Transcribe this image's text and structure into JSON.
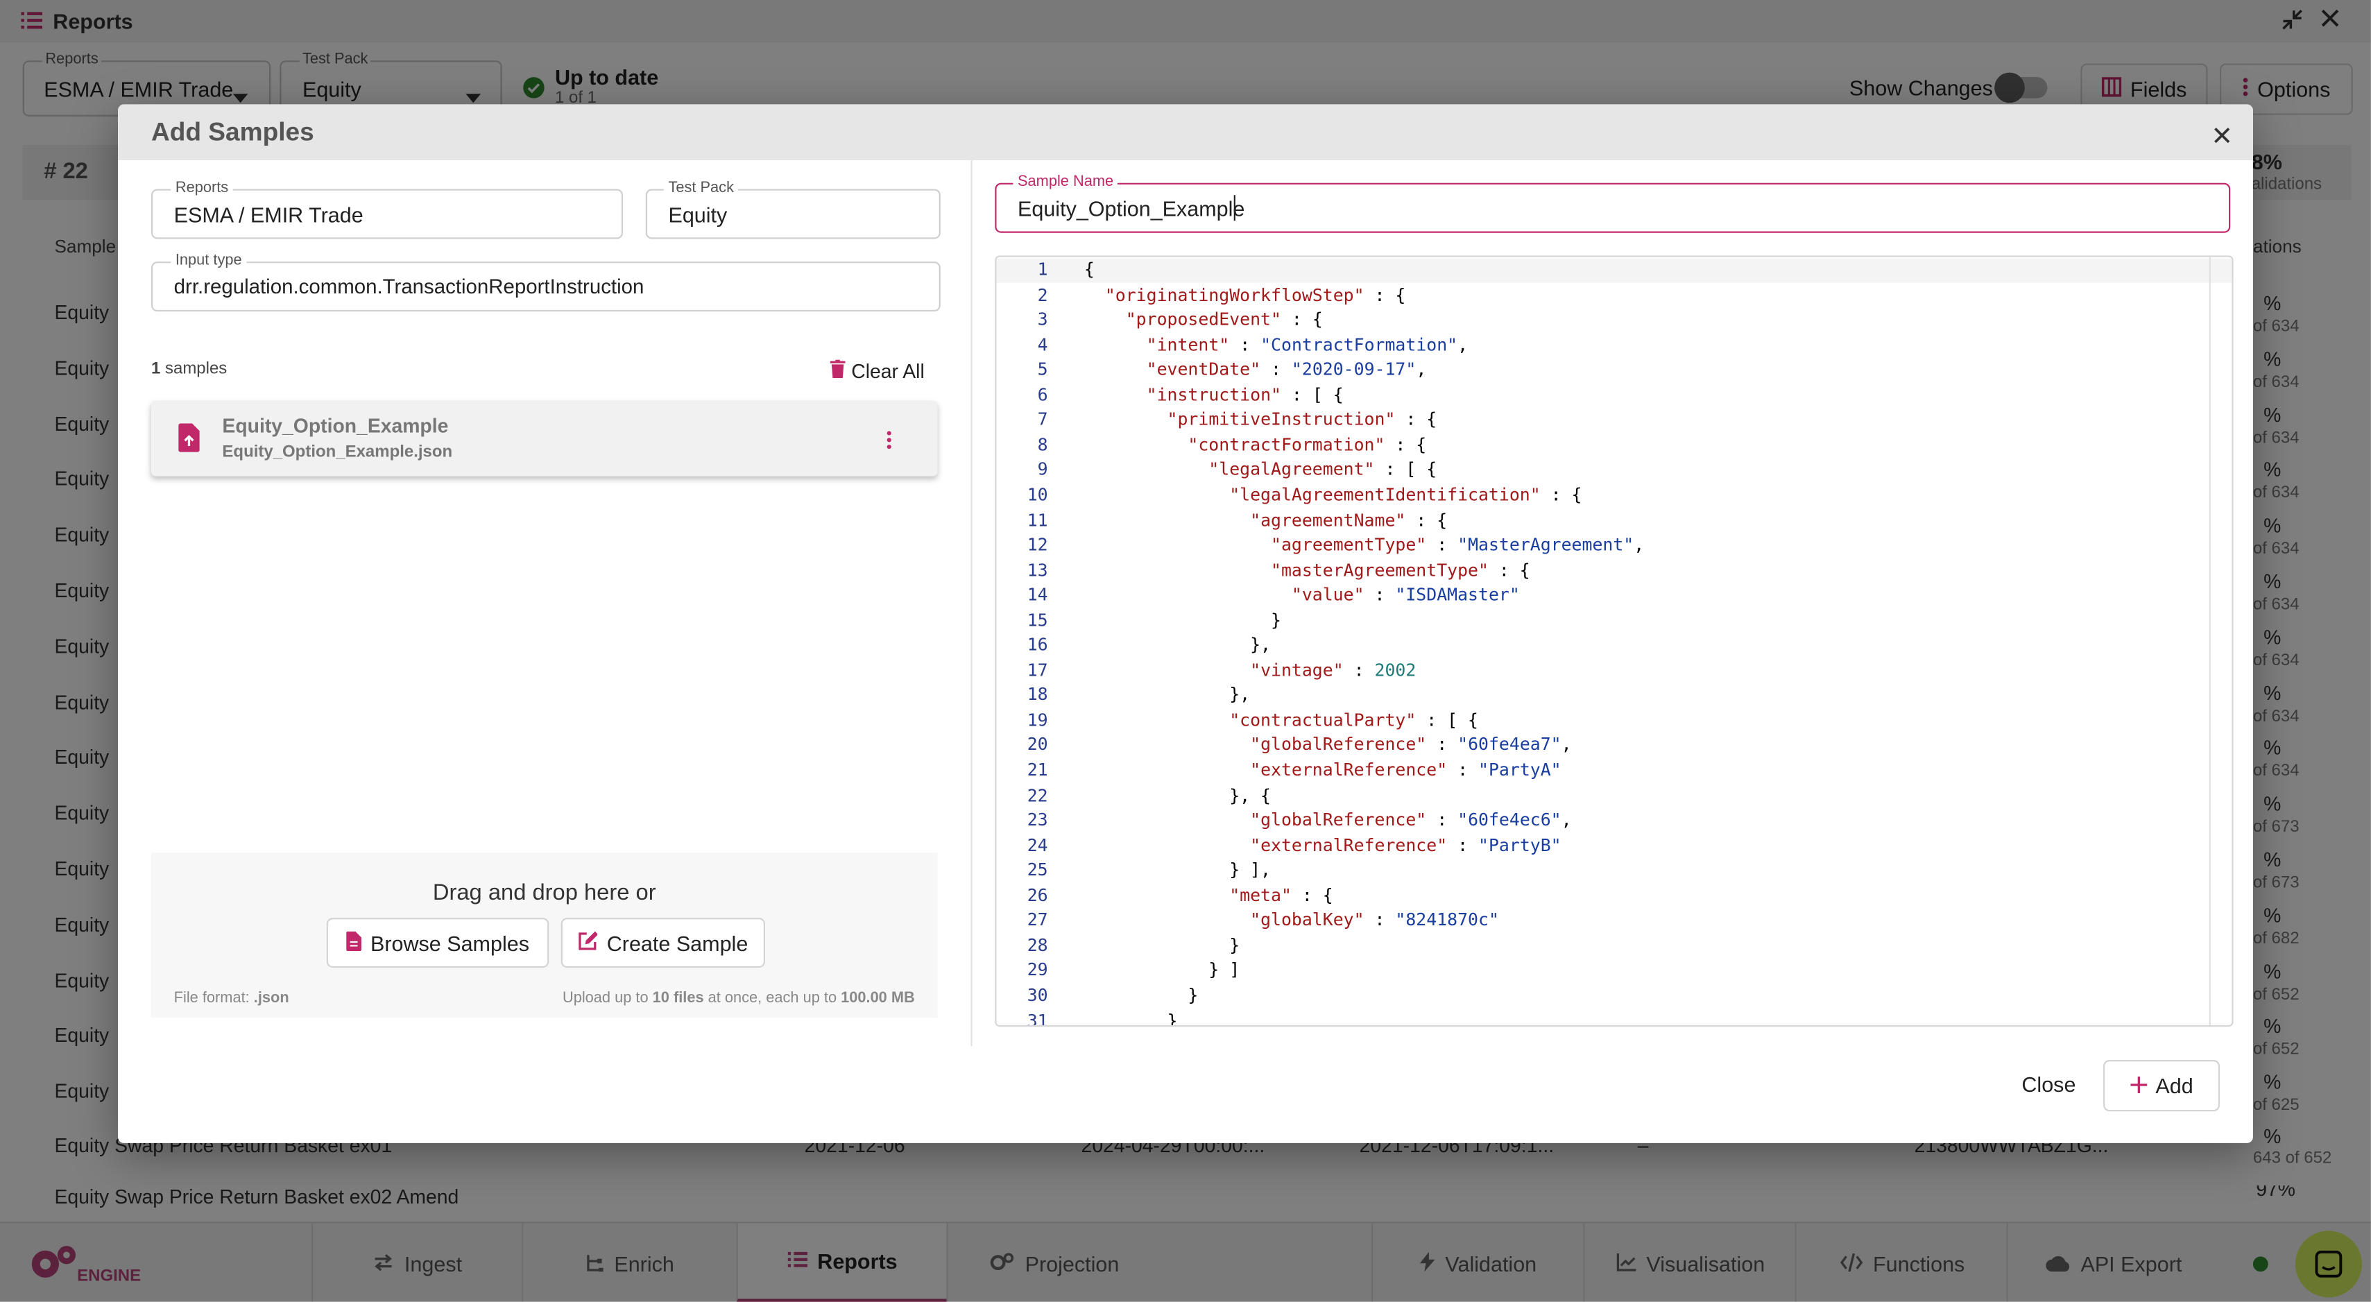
{
  "app": {
    "title": "Reports",
    "toolbar": {
      "reports_label": "Reports",
      "reports_value": "ESMA / EMIR Trade",
      "testpack_label": "Test Pack",
      "testpack_value": "Equity",
      "status_title": "Up to date",
      "status_sub": "1 of 1",
      "show_changes_label": "Show Changes",
      "fields_label": "Fields",
      "options_label": "Options"
    },
    "count_label": "# 22",
    "stat_pct": "8%",
    "stat_label": "alidations",
    "col_sample": "Sample",
    "col_validations": "ations",
    "rows": [
      {
        "name": "Equity",
        "pct": "%",
        "sub": "of 634"
      },
      {
        "name": "Equity",
        "pct": "%",
        "sub": "of 634"
      },
      {
        "name": "Equity",
        "pct": "%",
        "sub": "of 634"
      },
      {
        "name": "Equity",
        "pct": "%",
        "sub": "of 634"
      },
      {
        "name": "Equity",
        "pct": "%",
        "sub": "of 634"
      },
      {
        "name": "Equity",
        "pct": "%",
        "sub": "of 634"
      },
      {
        "name": "Equity",
        "pct": "%",
        "sub": "of 634"
      },
      {
        "name": "Equity",
        "pct": "%",
        "sub": "of 634"
      },
      {
        "name": "Equity",
        "pct": "%",
        "sub": "of 634"
      },
      {
        "name": "Equity",
        "pct": "%",
        "sub": "of 673"
      },
      {
        "name": "Equity",
        "pct": "%",
        "sub": "of 673"
      },
      {
        "name": "Equity",
        "pct": "%",
        "sub": "of 682"
      },
      {
        "name": "Equity",
        "pct": "%",
        "sub": "of 652"
      },
      {
        "name": "Equity",
        "pct": "%",
        "sub": "of 652"
      },
      {
        "name": "Equity",
        "pct": "%",
        "sub": "of 625"
      }
    ],
    "bottom_row": {
      "name": "Equity Swap Price Return Basket ex01",
      "c1": "2021-12-06",
      "c2": "2024-04-29T00:00:...",
      "c3": "2021-12-06T17:09:1...",
      "c4": "–",
      "c5": "213800WWTABZ1G...",
      "pct": "%",
      "sub": "643 of 652"
    },
    "cut_row": {
      "name": "Equity Swap Price Return Basket ex02 Amend",
      "pct": "97%"
    },
    "nav": {
      "logo_text": "ENGINE",
      "tabs": [
        "Ingest",
        "Enrich",
        "Reports",
        "Projection",
        "Validation",
        "Visualisation",
        "Functions",
        "API Export"
      ]
    },
    "colors": {
      "accent": "#c0286a",
      "nav_active": "#b8457b",
      "status_green": "#2e8b2e",
      "chat": "#d4ef5c"
    }
  },
  "modal": {
    "title": "Add Samples",
    "reports_label": "Reports",
    "reports_value": "ESMA / EMIR Trade",
    "testpack_label": "Test Pack",
    "testpack_value": "Equity",
    "input_type_label": "Input type",
    "input_type_value": "drr.regulation.common.TransactionReportInstruction",
    "samples_count": "1",
    "samples_label": " samples",
    "clear_all": "Clear All",
    "sample": {
      "name": "Equity_Option_Example",
      "file": "Equity_Option_Example.json"
    },
    "dropzone": {
      "text": "Drag and drop here or",
      "browse": "Browse Samples",
      "create": "Create Sample",
      "format_prefix": "File format: ",
      "format_value": ".json",
      "upload_1": "Upload up to ",
      "upload_2": "10 files",
      "upload_3": " at once, each up to ",
      "upload_4": "100.00 MB"
    },
    "sample_name_label": "Sample Name",
    "sample_name_value": "Equity_Option_Example",
    "code_lines": [
      "{",
      "  \"originatingWorkflowStep\" : {",
      "    \"proposedEvent\" : {",
      "      \"intent\" : \"ContractFormation\",",
      "      \"eventDate\" : \"2020-09-17\",",
      "      \"instruction\" : [ {",
      "        \"primitiveInstruction\" : {",
      "          \"contractFormation\" : {",
      "            \"legalAgreement\" : [ {",
      "              \"legalAgreementIdentification\" : {",
      "                \"agreementName\" : {",
      "                  \"agreementType\" : \"MasterAgreement\",",
      "                  \"masterAgreementType\" : {",
      "                    \"value\" : \"ISDAMaster\"",
      "                  }",
      "                },",
      "                \"vintage\" : 2002",
      "              },",
      "              \"contractualParty\" : [ {",
      "                \"globalReference\" : \"60fe4ea7\",",
      "                \"externalReference\" : \"PartyA\"",
      "              }, {",
      "                \"globalReference\" : \"60fe4ec6\",",
      "                \"externalReference\" : \"PartyB\"",
      "              } ],",
      "              \"meta\" : {",
      "                \"globalKey\" : \"8241870c\"",
      "              }",
      "            } ]",
      "          }",
      "        }"
    ],
    "close_label": "Close",
    "add_label": "Add"
  }
}
